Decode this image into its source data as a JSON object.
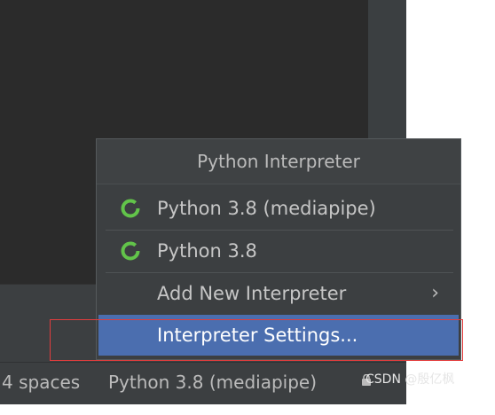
{
  "status_bar": {
    "indent": "4 spaces",
    "interpreter": "Python 3.8 (mediapipe)"
  },
  "popup": {
    "title": "Python Interpreter",
    "items": [
      {
        "label": "Python 3.8 (mediapipe)",
        "icon": "python-env-ring-icon"
      },
      {
        "label": "Python 3.8",
        "icon": "python-env-ring-icon"
      },
      {
        "label": "Add New Interpreter",
        "icon": "chevron-right-icon"
      },
      {
        "label": "Interpreter Settings..."
      }
    ]
  },
  "watermark": "CSDN @殷亿枫",
  "colors": {
    "selection": "#4b6eaf",
    "ring": "#62c44a",
    "highlight_border": "#e23d3d"
  }
}
